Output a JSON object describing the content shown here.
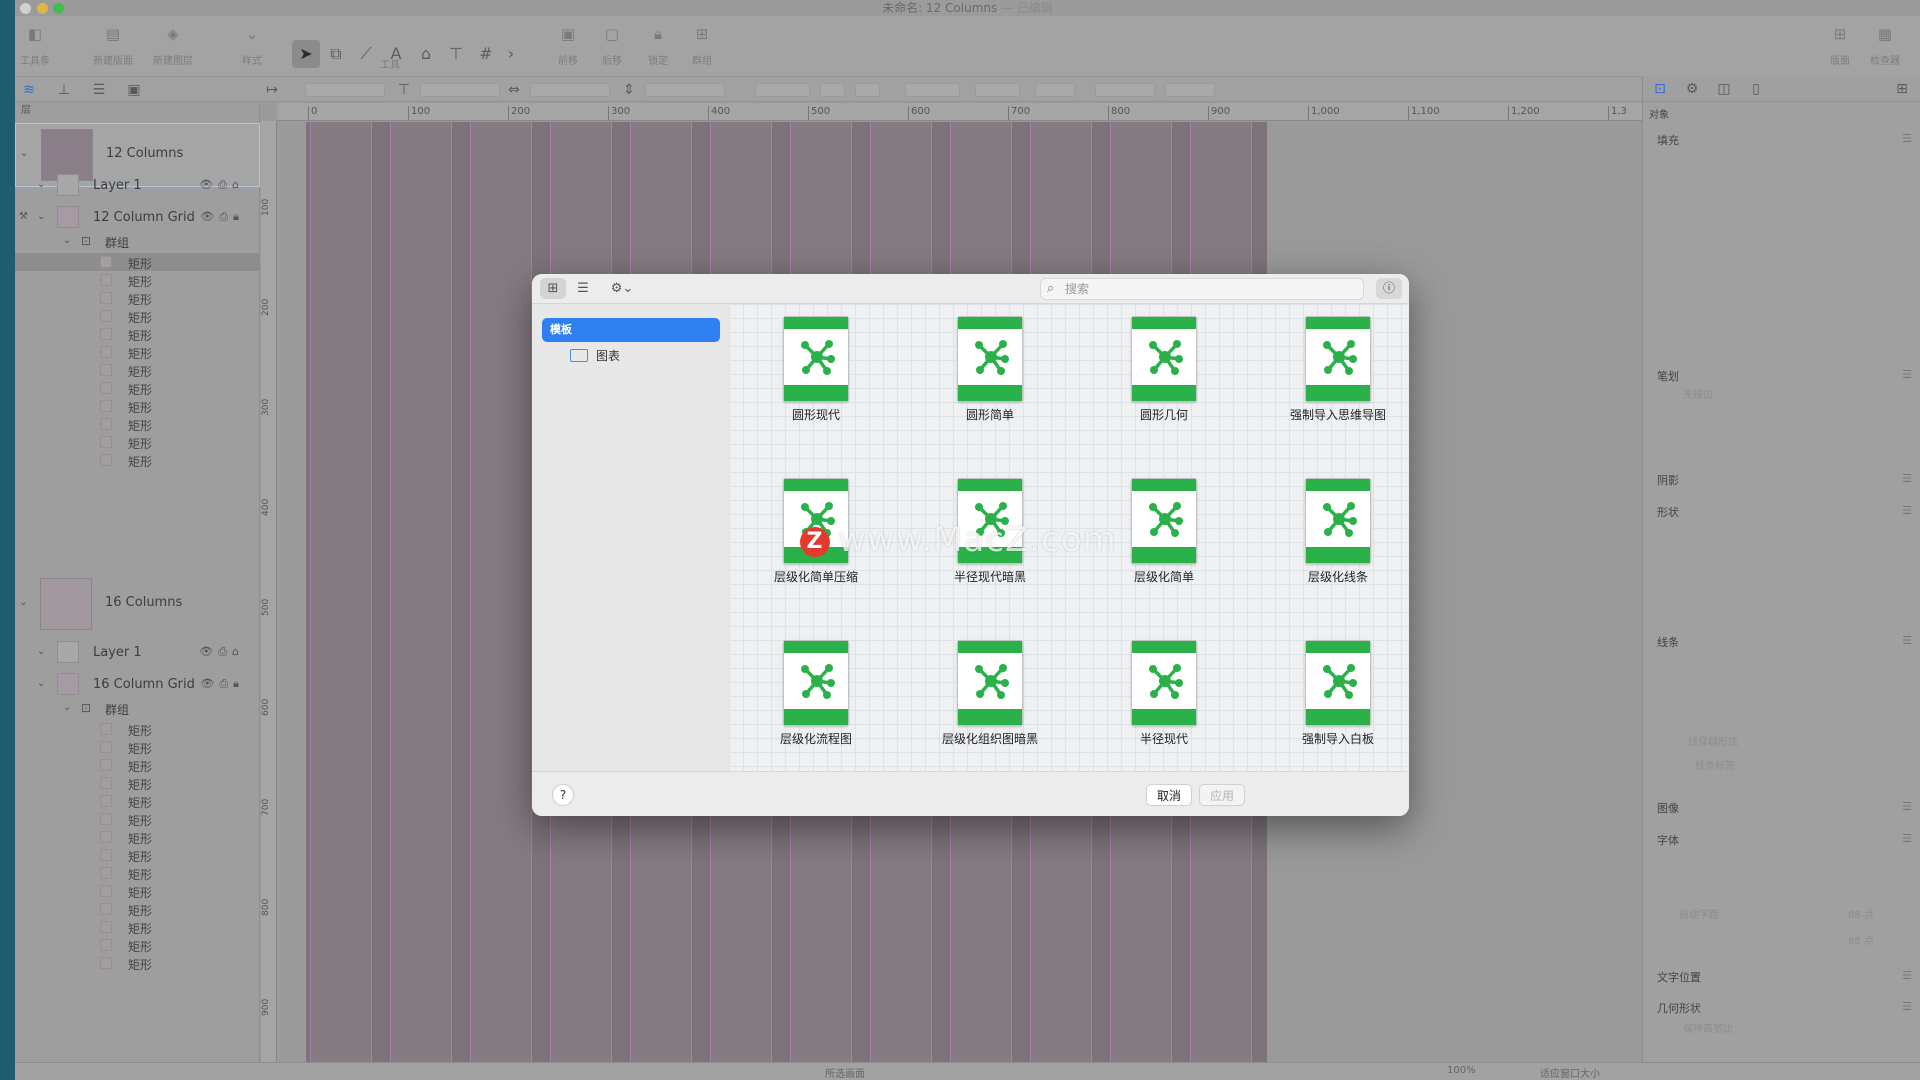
{
  "window": {
    "title": "未命名: 12 Columns",
    "subtitle": "— 已编辑"
  },
  "toolbar": {
    "items": [
      {
        "label": "工具条"
      },
      {
        "label": "新建版面"
      },
      {
        "label": "新建图层"
      },
      {
        "label": "样式"
      },
      {
        "label": "工具"
      },
      {
        "label": "前移"
      },
      {
        "label": "后移"
      },
      {
        "label": "锁定"
      },
      {
        "label": "群组"
      },
      {
        "label": "版面"
      },
      {
        "label": "检查器"
      }
    ]
  },
  "layers_panel": {
    "header": "层",
    "canvas1": {
      "name": "12 Columns",
      "layer": "Layer 1",
      "grid": "12 Column Grid",
      "group": "群组",
      "rects": [
        "矩形",
        "矩形",
        "矩形",
        "矩形",
        "矩形",
        "矩形",
        "矩形",
        "矩形",
        "矩形",
        "矩形",
        "矩形",
        "矩形"
      ]
    },
    "canvas2": {
      "name": "16 Columns",
      "layer": "Layer 1",
      "grid": "16 Column Grid",
      "group": "群组",
      "rects": [
        "矩形",
        "矩形",
        "矩形",
        "矩形",
        "矩形",
        "矩形",
        "矩形",
        "矩形",
        "矩形",
        "矩形",
        "矩形",
        "矩形",
        "矩形",
        "矩形"
      ]
    }
  },
  "ruler": {
    "top": [
      "0",
      "100",
      "200",
      "300",
      "400",
      "500",
      "600",
      "700",
      "800",
      "900",
      "1,000",
      "1,100",
      "1,200",
      "1,3"
    ],
    "left": [
      "100",
      "200",
      "300",
      "400",
      "500",
      "600",
      "700",
      "800",
      "900"
    ]
  },
  "inspector": {
    "header": "对象",
    "sections": [
      "填充",
      "笔划",
      "阴影",
      "形状",
      "线条",
      "图像",
      "字体",
      "文字位置",
      "几何形状"
    ],
    "stroke_value": "无描边",
    "line_labels": [
      "线穿越形式",
      "线条标签"
    ],
    "font_auto": "自动字距",
    "font_size_a": "88 点",
    "font_size_b": "88 点",
    "geometry_opt": "保持高宽比"
  },
  "status": {
    "center": "所选画面",
    "zoom": "100%",
    "fit": "适应窗口大小"
  },
  "dialog": {
    "search_placeholder": "搜索",
    "sidebar": {
      "selected": "模板",
      "folder": "图表"
    },
    "templates": [
      "圆形现代",
      "圆形简单",
      "圆形几何",
      "强制导入思维导图",
      "层级化简单压缩",
      "半径现代暗黑",
      "层级化简单",
      "层级化线条",
      "层级化流程图",
      "层级化组织图暗黑",
      "半径现代",
      "强制导入白板"
    ],
    "help": "?",
    "cancel": "取消",
    "apply": "应用"
  },
  "watermark": {
    "badge": "Z",
    "text": "www.MacZ.com"
  }
}
